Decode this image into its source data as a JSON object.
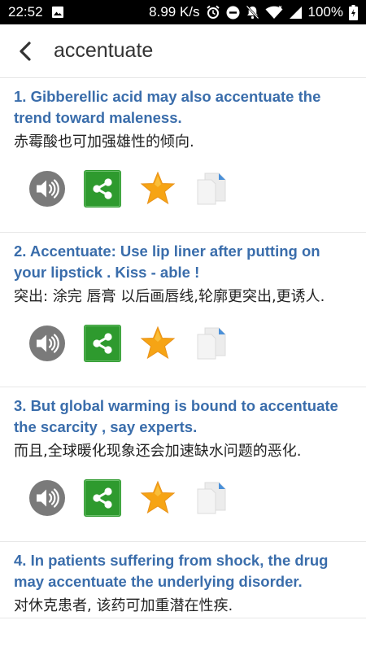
{
  "status_bar": {
    "time": "22:52",
    "speed": "8.99 K/s",
    "battery": "100%"
  },
  "header": {
    "title": "accentuate"
  },
  "entries": [
    {
      "sentence": "1. Gibberellic acid may also accentuate the trend toward maleness.",
      "translation": "赤霉酸也可加强雄性的倾向."
    },
    {
      "sentence": "2. Accentuate: Use  lip  liner after putting on your lipstick . Kiss - able !",
      "translation": "突出: 涂完 唇膏 以后画唇线,轮廓更突出,更诱人."
    },
    {
      "sentence": "3. But global warming is bound to accentuate the scarcity , say experts.",
      "translation": "而且,全球暖化现象还会加速缺水问题的恶化."
    },
    {
      "sentence": "4. In patients suffering from shock, the drug may accentuate the underlying disorder.",
      "translation": "对休克患者, 该药可加重潜在性疾."
    }
  ],
  "colors": {
    "sentence": "#3a6dab",
    "share_green": "#2e9a2e",
    "star": "#f6a414",
    "speaker_gray": "#7a7a7a"
  },
  "icons": [
    "speaker-icon",
    "share-icon",
    "star-icon",
    "copy-icon"
  ]
}
